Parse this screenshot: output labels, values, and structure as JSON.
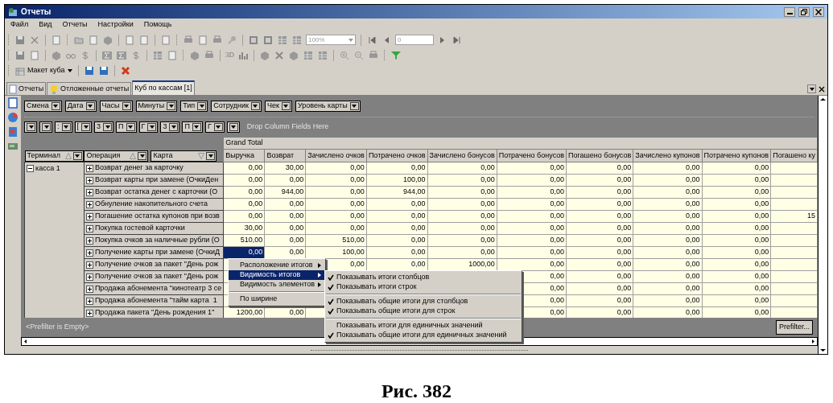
{
  "window": {
    "title": "Отчеты"
  },
  "menu_bar": [
    "Файл",
    "Вид",
    "Отчеты",
    "Настройки",
    "Помощь"
  ],
  "toolbar": {
    "zoom": "100%",
    "page": "0",
    "chart_3d": "3D",
    "layout_button": "Макет куба"
  },
  "tabs": [
    {
      "label": "Отчеты",
      "selected": false
    },
    {
      "label": "Отложенные отчеты",
      "selected": false
    },
    {
      "label": "Куб по кассам [1]",
      "selected": true
    }
  ],
  "pivot": {
    "filter_fields": [
      "Смена",
      "Дата",
      "Часы",
      "Минуты",
      "Тип",
      "Сотрудник",
      "Чек",
      "Уровень карты"
    ],
    "column_fields": [
      {
        "kind": "dropdown"
      },
      {
        "kind": "dropdown"
      },
      {
        "kind": "field",
        "label": ":"
      },
      {
        "kind": "field",
        "label": "["
      },
      {
        "kind": "field",
        "label": "3"
      },
      {
        "kind": "field",
        "label": "П"
      },
      {
        "kind": "field",
        "label": "Г"
      },
      {
        "kind": "field",
        "label": "3"
      },
      {
        "kind": "field",
        "label": "П"
      },
      {
        "kind": "field",
        "label": "Г"
      },
      {
        "kind": "dropdown"
      }
    ],
    "column_drop_hint": "Drop Column Fields Here",
    "row_fields": [
      {
        "label": "Терминал",
        "sort_descending": false
      },
      {
        "label": "Операция",
        "sort_descending": false
      },
      {
        "label": "Карта",
        "sort_descending": true
      }
    ],
    "grand_total": "Grand Total",
    "columns": [
      "Выручка",
      "Возврат",
      "Зачислено очков",
      "Потрачено очков",
      "Зачислено бонусов",
      "Потрачено бонусов",
      "Погашено бонусов",
      "Зачислено купонов",
      "Потрачено купонов",
      "Погашено ку"
    ],
    "terminal": {
      "label": "касса 1",
      "expanded": true
    },
    "rows": [
      {
        "operation": "Возврат денег за карточку",
        "kind": "full",
        "selected": false,
        "values": [
          "0,00",
          "30,00",
          "0,00",
          "0,00",
          "0,00",
          "0,00",
          "0,00",
          "0,00",
          "0,00"
        ]
      },
      {
        "operation": "Возврат карты при замене (ОчкиДен",
        "kind": "full",
        "selected": false,
        "values": [
          "0,00",
          "0,00",
          "0,00",
          "100,00",
          "0,00",
          "0,00",
          "0,00",
          "0,00",
          "0,00"
        ]
      },
      {
        "operation": "Возврат остатка денег с карточки (О",
        "kind": "full",
        "selected": false,
        "values": [
          "0,00",
          "944,00",
          "0,00",
          "944,00",
          "0,00",
          "0,00",
          "0,00",
          "0,00",
          "0,00"
        ]
      },
      {
        "operation": "Обнуление накопительного счета",
        "kind": "full",
        "selected": false,
        "values": [
          "0,00",
          "0,00",
          "0,00",
          "0,00",
          "0,00",
          "0,00",
          "0,00",
          "0,00",
          "0,00"
        ]
      },
      {
        "operation": "Погашение остатка купонов при возв",
        "kind": "full",
        "selected": false,
        "values": [
          "0,00",
          "0,00",
          "0,00",
          "0,00",
          "0,00",
          "0,00",
          "0,00",
          "0,00",
          "0,00",
          "15"
        ]
      },
      {
        "operation": "Покупка гостевой карточки",
        "kind": "full",
        "selected": false,
        "values": [
          "30,00",
          "0,00",
          "0,00",
          "0,00",
          "0,00",
          "0,00",
          "0,00",
          "0,00",
          "0,00"
        ]
      },
      {
        "operation": "Покупка очков за наличные рубли (О",
        "kind": "full",
        "selected": false,
        "values": [
          "510,00",
          "0,00",
          "510,00",
          "0,00",
          "0,00",
          "0,00",
          "0,00",
          "0,00",
          "0,00"
        ]
      },
      {
        "operation": "Получение карты при замене (ОчкиД",
        "kind": "full",
        "selected": true,
        "values": [
          "0,00",
          "0,00",
          "100,00",
          "0,00",
          "0,00",
          "0,00",
          "0,00",
          "0,00",
          "0,00"
        ]
      },
      {
        "operation": "Получение очков за пакет \"День рож",
        "kind": "menu_covered",
        "selected": false,
        "values": [
          "0,00",
          "0,00",
          "1000,00",
          "0,00",
          "0,00",
          "0,00",
          "0,00"
        ]
      },
      {
        "operation": "Получение очков за пакет \"День рож",
        "kind": "both_covered",
        "selected": false,
        "values": [
          "0,00",
          "0,00",
          "0,00",
          "0,00"
        ]
      },
      {
        "operation": "Продажа абонемента \"кинотеатр 3 се",
        "kind": "both_covered",
        "selected": false,
        "values": [
          "0,00",
          "0,00",
          "0,00",
          "0,00"
        ]
      },
      {
        "operation": "Продажа абонемента \"тайм карта  1",
        "kind": "both_covered",
        "selected": false,
        "values": [
          "0,00",
          "0,00",
          "0,00",
          "0,00"
        ]
      },
      {
        "operation": "Продажа пакета \"День рождения 1\"",
        "kind": "submenu_covered",
        "selected": false,
        "values": [
          "1200,00",
          "0,00",
          "0,00",
          "0,00",
          "0,00",
          "0,00"
        ]
      }
    ],
    "prefilter": "<Prefilter is Empty>",
    "prefilter_button": "Prefilter..."
  },
  "context_menu": [
    {
      "kind": "submenu",
      "label": "Расположение итогов",
      "selected": false
    },
    {
      "kind": "submenu",
      "label": "Видимость итогов",
      "selected": true
    },
    {
      "kind": "submenu",
      "label": "Видимость элементов",
      "selected": false
    },
    {
      "kind": "separator"
    },
    {
      "kind": "item",
      "label": "По ширине",
      "selected": false
    }
  ],
  "submenu": [
    {
      "kind": "item",
      "label": "Показывать итоги столбцов",
      "checked": true
    },
    {
      "kind": "item",
      "label": "Показывать итоги строк",
      "checked": true
    },
    {
      "kind": "separator"
    },
    {
      "kind": "item",
      "label": "Показывать общие итоги для столбцов",
      "checked": true
    },
    {
      "kind": "item",
      "label": "Показывать общие итоги для строк",
      "checked": true
    },
    {
      "kind": "separator"
    },
    {
      "kind": "item",
      "label": "Показывать итоги для единичных значений",
      "checked": false
    },
    {
      "kind": "item",
      "label": "Показывать общие итоги для единичных значений",
      "checked": true
    }
  ],
  "caption": "Рис. 382"
}
